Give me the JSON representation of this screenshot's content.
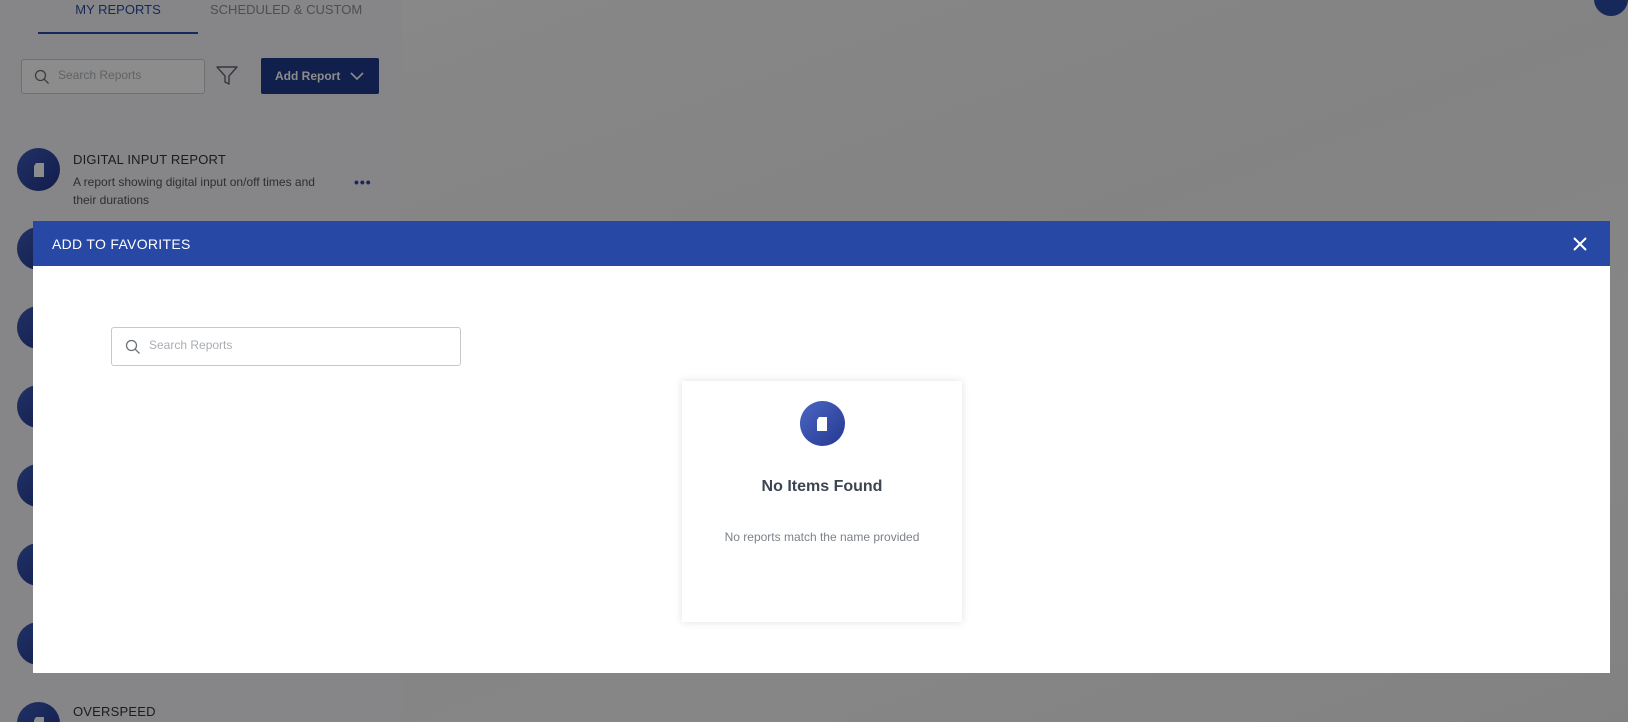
{
  "background": {
    "tabs": [
      {
        "label": "MY REPORTS",
        "active": true
      },
      {
        "label": "SCHEDULED & CUSTOM",
        "active": false
      }
    ],
    "search_placeholder": "Search Reports",
    "add_report_label": "Add Report",
    "reports": [
      {
        "title": "DIGITAL INPUT REPORT",
        "description": "A report showing digital input on/off times and their durations"
      },
      {
        "title": "OVERSPEED",
        "description": ""
      }
    ],
    "more_label": "•••"
  },
  "modal": {
    "title": "ADD TO FAVORITES",
    "search_placeholder": "Search Reports",
    "empty_state": {
      "title": "No Items Found",
      "message": "No reports match the name provided"
    }
  },
  "colors": {
    "header_blue": "#2749a5",
    "button_blue": "#1f3a8a",
    "overlay": "rgba(0,0,0,0.45)"
  }
}
